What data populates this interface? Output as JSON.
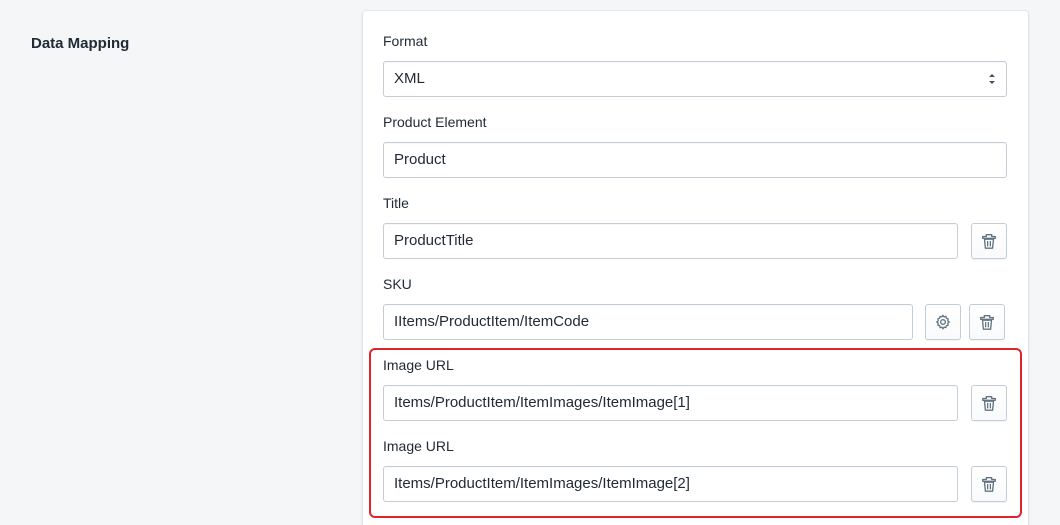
{
  "section": {
    "title": "Data Mapping"
  },
  "format": {
    "label": "Format",
    "value": "XML"
  },
  "product_element": {
    "label": "Product Element",
    "value": "Product"
  },
  "title_field": {
    "label": "Title",
    "value": "ProductTitle"
  },
  "sku_field": {
    "label": "SKU",
    "value": "IItems/ProductItem/ItemCode"
  },
  "image_urls": [
    {
      "label": "Image URL",
      "value": "Items/ProductItem/ItemImages/ItemImage[1]"
    },
    {
      "label": "Image URL",
      "value": "Items/ProductItem/ItemImages/ItemImage[2]"
    }
  ],
  "icons": {
    "delete": "trash-icon",
    "settings": "gear-icon",
    "select": "select-arrows-icon"
  },
  "colors": {
    "highlight": "#e0242b",
    "border": "#c4cdd5",
    "text": "#212b36"
  }
}
